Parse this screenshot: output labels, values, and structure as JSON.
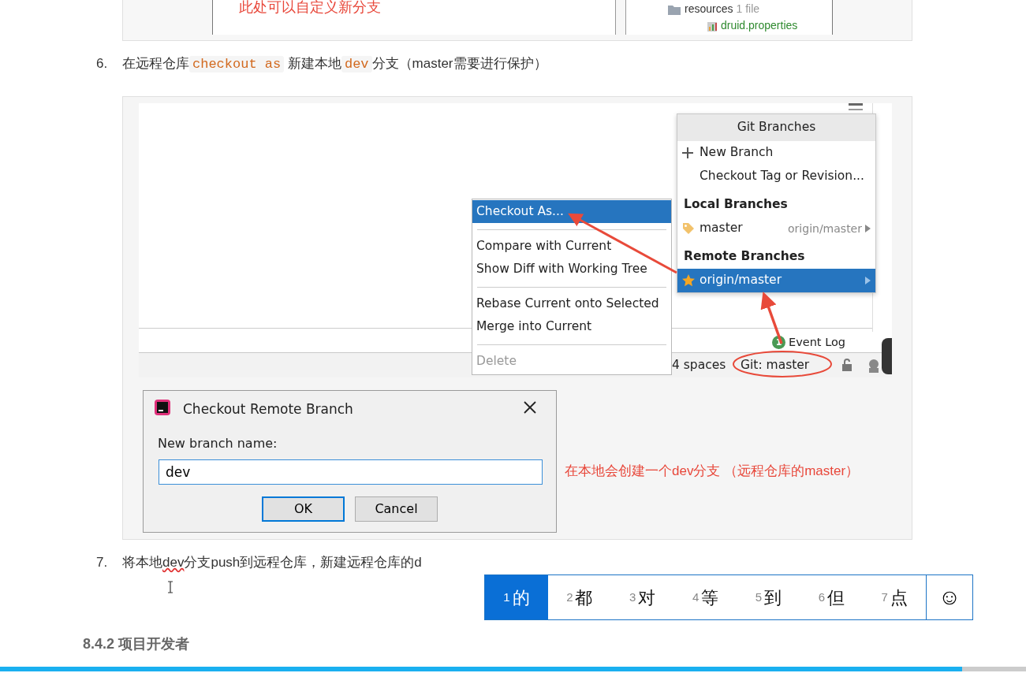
{
  "top_image": {
    "annotation": "此处可以自定义新分支",
    "tree_items": [
      {
        "label": "resources",
        "count": "1 file"
      },
      {
        "label": "druid.properties"
      }
    ]
  },
  "step_6": {
    "number": "6.",
    "segments": [
      {
        "kind": "text",
        "text": "在远程仓库"
      },
      {
        "kind": "code",
        "text": "checkout as"
      },
      {
        "kind": "text",
        "text": " 新建本地"
      },
      {
        "kind": "code",
        "text": "dev"
      },
      {
        "kind": "text",
        "text": "分支（master需要进行保护）"
      }
    ]
  },
  "screenshot": {
    "status_bar": {
      "indent": "4 spaces",
      "git_branch": "Git: master",
      "event_log": {
        "badge": "1",
        "label": "Event Log"
      }
    },
    "git_branches": {
      "title": "Git Branches",
      "items": [
        {
          "kind": "action",
          "label": "New Branch",
          "selected": false
        },
        {
          "kind": "action",
          "label": "Checkout Tag or Revision...",
          "selected": false
        },
        {
          "kind": "header",
          "label": "Local Branches"
        },
        {
          "kind": "branch",
          "label": "master",
          "tracking": "origin/master",
          "selected": false
        },
        {
          "kind": "header",
          "label": "Remote Branches"
        },
        {
          "kind": "branch",
          "label": "origin/master",
          "selected": true
        }
      ]
    },
    "context_menu": {
      "items": [
        {
          "kind": "item",
          "label": "Checkout As...",
          "selected": true,
          "disabled": false
        },
        {
          "kind": "separator"
        },
        {
          "kind": "item",
          "label": "Compare with Current",
          "selected": false,
          "disabled": false
        },
        {
          "kind": "item",
          "label": "Show Diff with Working Tree",
          "selected": false,
          "disabled": false
        },
        {
          "kind": "separator"
        },
        {
          "kind": "item",
          "label": "Rebase Current onto Selected",
          "selected": false,
          "disabled": false
        },
        {
          "kind": "item",
          "label": "Merge into Current",
          "selected": false,
          "disabled": false
        },
        {
          "kind": "separator"
        },
        {
          "kind": "item",
          "label": "Delete",
          "selected": false,
          "disabled": true
        }
      ]
    },
    "dialog": {
      "title": "Checkout Remote Branch",
      "field_label": "New branch name:",
      "value": "dev",
      "buttons": [
        {
          "label": "OK",
          "default": true
        },
        {
          "label": "Cancel",
          "default": false
        }
      ]
    },
    "annotation": "在本地会创建一个dev分支 （远程仓库的master）"
  },
  "step_7": {
    "number": "7.",
    "segments": [
      {
        "kind": "text",
        "text": "将本地"
      },
      {
        "kind": "misspelled",
        "text": "dev"
      },
      {
        "kind": "text",
        "text": "分支push到远程仓库，新建远程仓库的d"
      }
    ]
  },
  "ime_candidates": {
    "items": [
      {
        "number": "1",
        "text": "的",
        "selected": true
      },
      {
        "number": "2",
        "text": "都",
        "selected": false
      },
      {
        "number": "3",
        "text": "对",
        "selected": false
      },
      {
        "number": "4",
        "text": "等",
        "selected": false
      },
      {
        "number": "5",
        "text": "到",
        "selected": false
      },
      {
        "number": "6",
        "text": "但",
        "selected": false
      },
      {
        "number": "7",
        "text": "点",
        "selected": false
      }
    ],
    "emoji_button": "☺"
  },
  "heading": "8.4.2 项目开发者",
  "video_progress": {
    "level": 0.938
  }
}
